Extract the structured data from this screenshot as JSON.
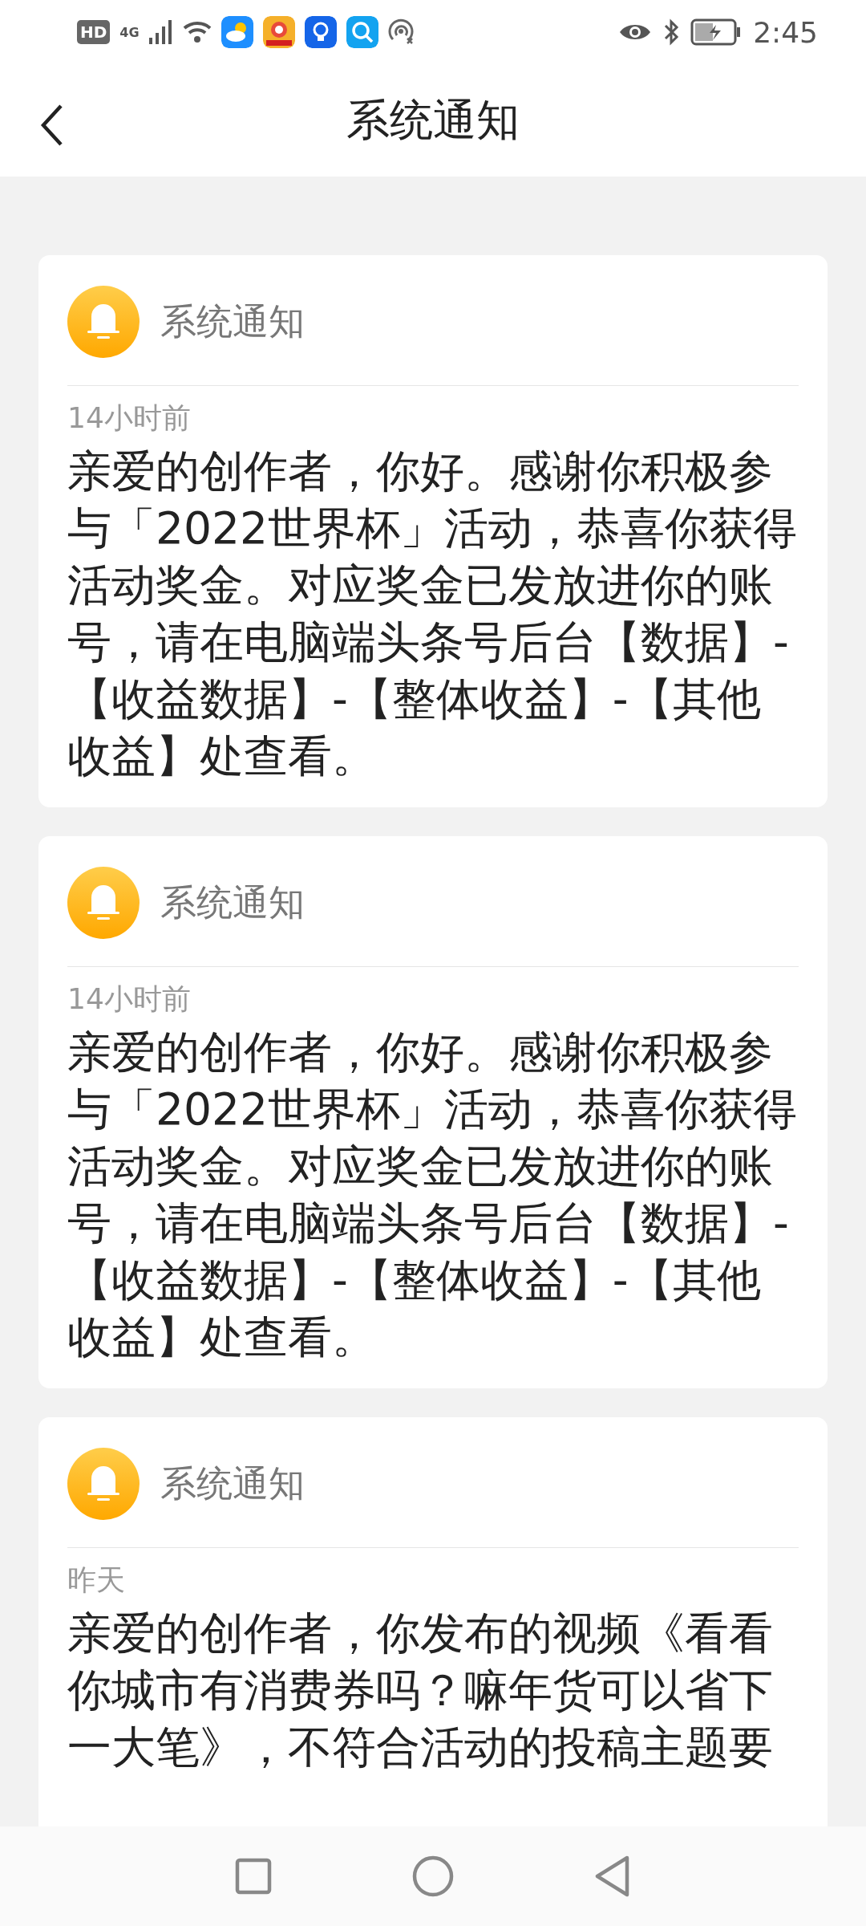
{
  "status_bar": {
    "time": "2:45",
    "hd_badge": "HD",
    "network": "4G"
  },
  "header": {
    "title": "系统通知"
  },
  "notifications": [
    {
      "sender": "系统通知",
      "time": "14小时前",
      "body": "亲爱的创作者，你好。感谢你积极参与「2022世界杯」活动，恭喜你获得活动奖金。对应奖金已发放进你的账号，请在电脑端头条号后台【数据】-【收益数据】-【整体收益】-【其他收益】处查看。"
    },
    {
      "sender": "系统通知",
      "time": "14小时前",
      "body": "亲爱的创作者，你好。感谢你积极参与「2022世界杯」活动，恭喜你获得活动奖金。对应奖金已发放进你的账号，请在电脑端头条号后台【数据】-【收益数据】-【整体收益】-【其他收益】处查看。"
    },
    {
      "sender": "系统通知",
      "time": "昨天",
      "body": "亲爱的创作者，你发布的视频《看看你城市有消费券吗？嘛年货可以省下一大笔》，不符合活动的投稿主题要"
    }
  ]
}
